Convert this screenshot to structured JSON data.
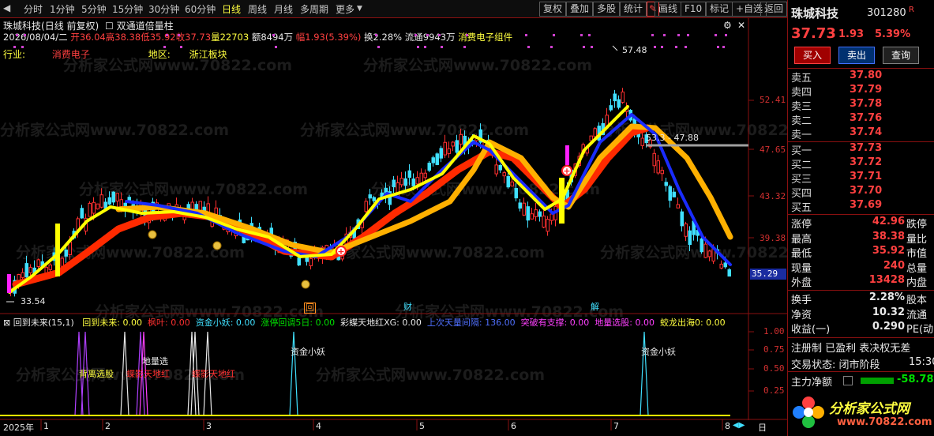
{
  "toolbar": {
    "periods": [
      "分时",
      "1分钟",
      "5分钟",
      "15分钟",
      "30分钟",
      "60分钟",
      "日线",
      "周线",
      "月线",
      "多周期",
      "更多"
    ],
    "active_period": "日线",
    "buttons": [
      "复权",
      "叠加",
      "多股",
      "统计",
      "画线",
      "F10",
      "标记",
      "+自选",
      "返回"
    ]
  },
  "header": {
    "stock_name": "珠城科技",
    "chart_mode": "(日线 前复权)",
    "indicator_name": "双通道倍量柱",
    "date": "2026/08/04/二",
    "open": "开36.04",
    "high": "高38.38",
    "low": "低35.92",
    "close": "收37.73",
    "volume": "量22703",
    "amount": "额8494万",
    "change": "幅1.93(5.39%)",
    "turnover": "换2.28%",
    "float": "流通9943万",
    "sector": "消费电子组件",
    "industry_label": "行业:",
    "industry_value": "消费电子",
    "region_label": "地区:",
    "region_value": "浙江板块"
  },
  "watermark": "分析家公式网www.70822.com",
  "price_axis": [
    "52.41",
    "47.65",
    "43.32",
    "39.38",
    "35.29"
  ],
  "chart_annotations": {
    "high_mark": "57.48",
    "low_mark": "33.54",
    "line_mark": "53.3 - 47.88",
    "bottom_markers": [
      "回",
      "财",
      "解"
    ]
  },
  "indicator_bar": {
    "title": "回到未来(15,1)",
    "items": [
      {
        "label": "回到未来: 0.00",
        "color": "#ffff40"
      },
      {
        "label": "枫叶: 0.00",
        "color": "#ff3030"
      },
      {
        "label": "资金小妖: 0.00",
        "color": "#40e0ff"
      },
      {
        "label": "涨停回调5日: 0.00",
        "color": "#00e000"
      },
      {
        "label": "彩蝶天地红XG: 0.00",
        "color": "#e8e8e8"
      },
      {
        "label": "上次天量间隔: 136.00",
        "color": "#5070ff"
      },
      {
        "label": "突破有支撑: 0.00",
        "color": "#ff40ff"
      },
      {
        "label": "地量选股: 0.00",
        "color": "#ff40ff"
      },
      {
        "label": "蛟龙出海0: 0.00",
        "color": "#ffff40"
      }
    ]
  },
  "indicator_axis": [
    "1.00",
    "0.75",
    "0.50",
    "0.25"
  ],
  "indicator_texts": [
    "背离选股",
    "地量选",
    "蝶影天地红",
    "蝶影天地红",
    "资金小妖",
    "资金小妖"
  ],
  "time_axis": [
    "2025年",
    "1",
    "2",
    "3",
    "4",
    "5",
    "6",
    "7",
    "8"
  ],
  "time_axis_end": "日",
  "quote": {
    "name": "珠城科技",
    "code": "301280",
    "r_badge": "R",
    "price": "37.73",
    "change": "1.93",
    "pct": "5.39%",
    "buy_btn": "买入",
    "sell_btn": "卖出",
    "query_btn": "查询",
    "asks": [
      {
        "label": "卖五",
        "price": "37.80"
      },
      {
        "label": "卖四",
        "price": "37.79"
      },
      {
        "label": "卖三",
        "price": "37.78"
      },
      {
        "label": "卖二",
        "price": "37.76"
      },
      {
        "label": "卖一",
        "price": "37.74"
      }
    ],
    "bids": [
      {
        "label": "买一",
        "price": "37.73"
      },
      {
        "label": "买二",
        "price": "37.72"
      },
      {
        "label": "买三",
        "price": "37.71"
      },
      {
        "label": "买四",
        "price": "37.70"
      },
      {
        "label": "买五",
        "price": "37.69"
      }
    ],
    "stats": [
      {
        "l1": "涨停",
        "v1": "42.96",
        "l2": "跌停"
      },
      {
        "l1": "最高",
        "v1": "38.38",
        "l2": "量比"
      },
      {
        "l1": "最低",
        "v1": "35.92",
        "l2": "市值"
      },
      {
        "l1": "现量",
        "v1": "240",
        "l2": "总量"
      },
      {
        "l1": "外盘",
        "v1": "13428",
        "l2": "内盘"
      }
    ],
    "stats2": [
      {
        "l1": "换手",
        "v1": "2.28%",
        "l2": "股本"
      },
      {
        "l1": "净资",
        "v1": "10.32",
        "l2": "流通"
      },
      {
        "l1": "收益(一)",
        "v1": "0.290",
        "l2": "PE(动)"
      }
    ],
    "info1": "注册制 已盈利 表决权无差",
    "trade_status_label": "交易状态: 闭市阶段",
    "trade_time": "15:30",
    "main_flow_label": "主力净额",
    "main_flow_value": "-58.78",
    "logo_text": "分析家公式网",
    "logo_url": "www.70822.com"
  }
}
